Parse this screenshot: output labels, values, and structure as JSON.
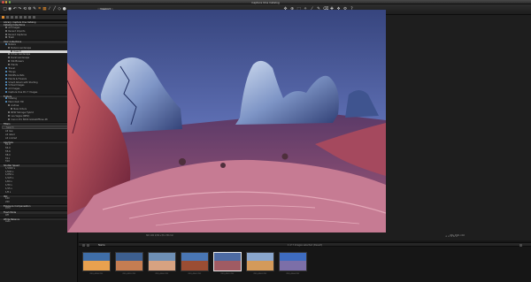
{
  "window": {
    "title": "Capture One Catalog"
  },
  "toolbar": {
    "viewer_label": "Viewport",
    "tools": [
      {
        "icon": "import-icon",
        "glyph": "▢"
      },
      {
        "icon": "camera-icon",
        "glyph": "◉"
      },
      {
        "icon": "undo-icon",
        "glyph": "↶"
      },
      {
        "icon": "redo-icon",
        "glyph": "↷"
      },
      {
        "icon": "rotate-icon",
        "glyph": "⟲"
      },
      {
        "icon": "settings-icon",
        "glyph": "⚙"
      },
      {
        "icon": "brush-icon",
        "glyph": "✎"
      },
      {
        "icon": "crop-icon",
        "glyph": "⌗"
      },
      {
        "icon": "grid-icon",
        "glyph": "▦"
      },
      {
        "icon": "eyedropper-icon",
        "glyph": "⁄"
      },
      {
        "icon": "straighten-icon",
        "glyph": "╱"
      },
      {
        "icon": "keystone-icon",
        "glyph": "◇"
      },
      {
        "icon": "mask-icon",
        "glyph": "●"
      }
    ],
    "right_tools": [
      {
        "icon": "pan-icon",
        "glyph": "✥"
      },
      {
        "icon": "zoom-icon",
        "glyph": "⊕"
      },
      {
        "icon": "select-icon",
        "glyph": "⬚"
      },
      {
        "icon": "spot-icon",
        "glyph": "✧"
      },
      {
        "icon": "picker-icon",
        "glyph": "⁄"
      },
      {
        "icon": "brush-icon",
        "glyph": "✎"
      },
      {
        "icon": "erase-icon",
        "glyph": "⌫"
      },
      {
        "icon": "heal-icon",
        "glyph": "✚"
      },
      {
        "icon": "clone-icon",
        "glyph": "❖"
      },
      {
        "icon": "settings-icon",
        "glyph": "⚙"
      },
      {
        "icon": "help-icon",
        "glyph": "?"
      }
    ]
  },
  "sidebar": {
    "library_title": "Library: Capture One Catalog",
    "catalog_collections": {
      "title": "Catalog Collections",
      "count": "Recent",
      "items": [
        {
          "label": "All Images",
          "count": "860"
        },
        {
          "label": "Recent Imports",
          "count": ""
        },
        {
          "label": "Recent Captures",
          "count": ""
        },
        {
          "label": "Trash",
          "count": ""
        }
      ]
    },
    "user_collections": {
      "title": "User Collections",
      "items": [
        {
          "label": "Nature",
          "count": "",
          "level": 0
        },
        {
          "label": "Nature Landscape",
          "count": "",
          "level": 1
        },
        {
          "label": "Desert",
          "count": "",
          "level": 2,
          "selected": true
        },
        {
          "label": "Urban Landscape",
          "count": "",
          "level": 1
        },
        {
          "label": "Rural Landscape",
          "count": "",
          "level": 1
        },
        {
          "label": "Wildflowers",
          "count": "",
          "level": 1
        },
        {
          "label": "Plants",
          "count": "",
          "level": 1
        },
        {
          "label": "Travel",
          "count": "",
          "level": 0
        },
        {
          "label": "Things",
          "count": "",
          "level": 0
        },
        {
          "label": "Wildlife & Pets",
          "count": "",
          "level": 0
        },
        {
          "label": "Plants & Flowers",
          "count": "",
          "level": 0
        },
        {
          "label": "Smart Album with Starting",
          "count": "",
          "level": 0
        },
        {
          "label": "Virtual Images",
          "count": "143",
          "level": 0
        },
        {
          "label": "All Images",
          "count": "860",
          "level": 0
        },
        {
          "label": "Capture One Pro 7 Images",
          "count": "",
          "level": 0
        }
      ]
    },
    "folders": {
      "title": "Folders",
      "items": [
        {
          "label": "Catalog",
          "count": "",
          "level": 0
        },
        {
          "label": "Macintosh HD",
          "count": "",
          "level": 0
        },
        {
          "label": "Andrea",
          "count": "",
          "level": 1
        },
        {
          "label": "New Orders",
          "count": "",
          "level": 2
        },
        {
          "label": "NEW Storage Hybrid",
          "count": "",
          "level": 1
        },
        {
          "label": "Las Vegas (NMV)",
          "count": "",
          "level": 1
        },
        {
          "label": "Canon Pro 8000 GlobalOffices 48",
          "count": "",
          "level": 1
        }
      ]
    },
    "filters": {
      "title": "Filters",
      "search_placeholder": "Search",
      "groups": [
        {
          "title": "",
          "rows": [
            {
              "label": "All raw",
              "count": "1"
            },
            {
              "label": "All rated",
              "count": "1"
            },
            {
              "label": "All colored",
              "count": "1"
            }
          ]
        },
        {
          "title": "Aperture",
          "rows": [
            {
              "label": "f/2.8",
              "count": "1"
            },
            {
              "label": "f/4.0",
              "count": "1"
            },
            {
              "label": "f/5.6",
              "count": "1"
            },
            {
              "label": "f/8.0",
              "count": "1"
            },
            {
              "label": "f/11",
              "count": "1"
            },
            {
              "label": "f/16",
              "count": "1"
            }
          ]
        },
        {
          "title": "Shutter Speed",
          "rows": [
            {
              "label": "1/1000 s",
              "count": "1"
            },
            {
              "label": "1/500 s",
              "count": "1"
            },
            {
              "label": "1/250 s",
              "count": "1"
            },
            {
              "label": "1/125 s",
              "count": "1"
            },
            {
              "label": "1/60 s",
              "count": "1"
            },
            {
              "label": "1/30 s",
              "count": "1"
            },
            {
              "label": "1/15 s",
              "count": "1"
            },
            {
              "label": "1/8 s",
              "count": "1"
            }
          ]
        },
        {
          "title": "ISO",
          "rows": [
            {
              "label": "100",
              "count": "1"
            },
            {
              "label": "200",
              "count": "1"
            }
          ]
        },
        {
          "title": "Exposure Compensation",
          "rows": [
            {
              "label": "0 EV",
              "count": "1"
            }
          ]
        },
        {
          "title": "Flash Mode",
          "rows": [
            {
              "label": "Off",
              "count": "1"
            }
          ]
        },
        {
          "title": "White Balance",
          "rows": [
            {
              "label": "Auto",
              "count": "1"
            }
          ]
        }
      ]
    }
  },
  "viewer": {
    "meta_left": "ISO 100   1/30 s   f/11   38 mm",
    "meta_right": "IMG_4561.CR2",
    "stars": "★★★★★"
  },
  "filmstrip": {
    "name": "Name",
    "info": "1 of 7 images selected (Desert)",
    "thumbs": [
      {
        "label": "IMG_4558.CR2",
        "colors": [
          "#e8a14f",
          "#3f6ea8"
        ],
        "selected": false
      },
      {
        "label": "IMG_4559.CR2",
        "colors": [
          "#c57d52",
          "#3d5f8f"
        ],
        "selected": false
      },
      {
        "label": "IMG_4560.CR2",
        "colors": [
          "#d7a281",
          "#6e8fb5"
        ],
        "selected": false
      },
      {
        "label": "IMG_4562.CR2",
        "colors": [
          "#9b4d33",
          "#4976b4"
        ],
        "selected": false
      },
      {
        "label": "IMG_4561.CR2",
        "colors": [
          "#a05b63",
          "#4d6ba3"
        ],
        "selected": true
      },
      {
        "label": "IMG_4563.CR2",
        "colors": [
          "#d49a5a",
          "#8aa6cc"
        ],
        "selected": false
      },
      {
        "label": "IMG_4564.CR2",
        "colors": [
          "#7c6fa8",
          "#3e6cc0"
        ],
        "selected": false
      }
    ]
  }
}
